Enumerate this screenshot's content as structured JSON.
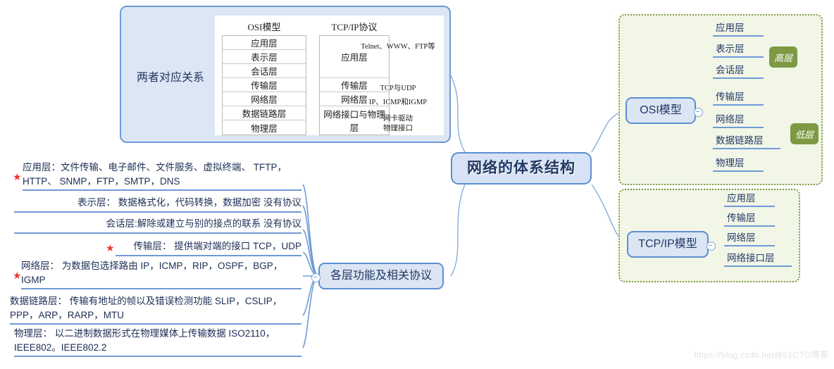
{
  "center": {
    "title": "网络的体系结构"
  },
  "compare": {
    "label": "两者对应关系",
    "osi_head": "OSI模型",
    "tcp_head": "TCP/IP协议",
    "osi_rows": [
      "应用层",
      "表示层",
      "会话层",
      "传输层",
      "网络层",
      "数据链路层",
      "物理层"
    ],
    "tcp_rows": [
      "应用层",
      "传输层",
      "网络层",
      "网络接口与物理层"
    ],
    "notes": [
      "Telnet、WWW、FTP等",
      "TCP与UDP",
      "IP、ICMP和IGMP",
      "网卡驱动\n物理接口"
    ]
  },
  "osi_branch": {
    "title": "OSI模型",
    "layers": [
      "应用层",
      "表示层",
      "会话层",
      "传输层",
      "网络层",
      "数据链路层",
      "物理层"
    ],
    "badges": {
      "upper": "高层",
      "lower": "低层"
    }
  },
  "tcp_branch": {
    "title": "TCP/IP模型",
    "layers": [
      "应用层",
      "传输层",
      "网络层",
      "网络接口层"
    ]
  },
  "functions_branch": {
    "title": "各层功能及相关协议",
    "items": [
      {
        "starred": true,
        "text": "应用层：文件传输、电子邮件、文件服务、虚拟终端、 TFTP，HTTP、 SNMP，FTP，SMTP，DNS"
      },
      {
        "starred": false,
        "text": "表示层： 数据格式化，代码转换，数据加密 没有协议"
      },
      {
        "starred": false,
        "text": "会话层:解除或建立与别的接点的联系 没有协议"
      },
      {
        "starred": true,
        "text": "传输层： 提供端对端的接口 TCP，UDP"
      },
      {
        "starred": true,
        "text": "网络层： 为数据包选择路由 IP，ICMP，RIP，OSPF，BGP，IGMP"
      },
      {
        "starred": false,
        "text": "数据链路层： 传输有地址的帧以及错误检测功能 SLIP，CSLIP，PPP，ARP，RARP，MTU"
      },
      {
        "starred": false,
        "text": "物理层： 以二进制数据形式在物理媒体上传输数据 ISO2110，IEEE802。IEEE802.2"
      }
    ]
  },
  "watermark": "https://blog.csdn.net@51CTO博客",
  "colors": {
    "node_fill": "#dbe5f3",
    "node_border": "#5b8fd1",
    "green_fill": "#f2f6e7",
    "green_border": "#7c9c3f",
    "badge": "#7d9a43",
    "star": "#e8392f",
    "text": "#213864"
  }
}
